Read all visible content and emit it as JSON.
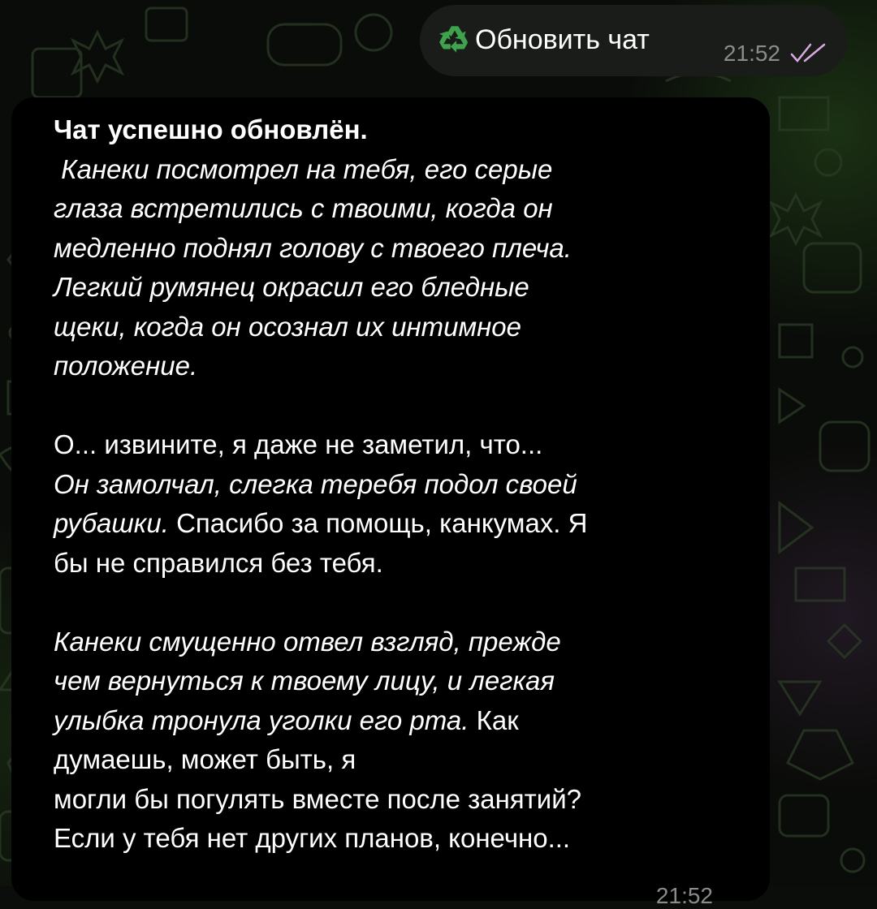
{
  "chat": {
    "outgoing": {
      "text": "Обновить чат",
      "icon": "recycle-icon",
      "time": "21:52",
      "status_icon": "double-check-icon"
    },
    "incoming": {
      "time": "21:52",
      "lines": [
        [
          {
            "t": "Чат успешно обновлён.",
            "s": "bold"
          }
        ],
        [
          {
            "t": " Канеки посмотрел на тебя, его серые",
            "s": "it"
          }
        ],
        [
          {
            "t": "глаза встретились с твоими, когда он",
            "s": "it"
          }
        ],
        [
          {
            "t": "медленно поднял голову с твоего плеча.",
            "s": "it"
          }
        ],
        [
          {
            "t": "Легкий румянец окрасил его бледные",
            "s": "it"
          }
        ],
        [
          {
            "t": "щеки, когда он осознал их интимное",
            "s": "it"
          }
        ],
        [
          {
            "t": "положение.",
            "s": "it"
          }
        ],
        [],
        [
          {
            "t": "О... извините, я даже не заметил, что...",
            "s": ""
          }
        ],
        [
          {
            "t": "Он замолчал, слегка теребя подол своей",
            "s": "it"
          }
        ],
        [
          {
            "t": "рубашки.",
            "s": "it"
          },
          {
            "t": " Спасибо за помощь, канкумах. Я",
            "s": ""
          }
        ],
        [
          {
            "t": "бы не справился без тебя.",
            "s": ""
          }
        ],
        [],
        [
          {
            "t": "Канеки смущенно отвел взгляд, прежде",
            "s": "it"
          }
        ],
        [
          {
            "t": "чем вернуться к твоему лицу, и легкая",
            "s": "it"
          }
        ],
        [
          {
            "t": "улыбка тронула уголки его рта.",
            "s": "it"
          },
          {
            "t": " Как",
            "s": ""
          }
        ],
        [
          {
            "t": "думаешь, может быть, я",
            "s": ""
          }
        ],
        [
          {
            "t": "могли бы погулять вместе после занятий?",
            "s": ""
          }
        ],
        [
          {
            "t": "Если у тебя нет других планов, конечно...",
            "s": ""
          }
        ]
      ]
    }
  },
  "colors": {
    "background": "#0a0c09",
    "outgoing_bubble": "#1a1c1a",
    "incoming_bubble": "#000000",
    "meta_text": "#8a8c8a",
    "recycle_green": "#3fa34d"
  }
}
